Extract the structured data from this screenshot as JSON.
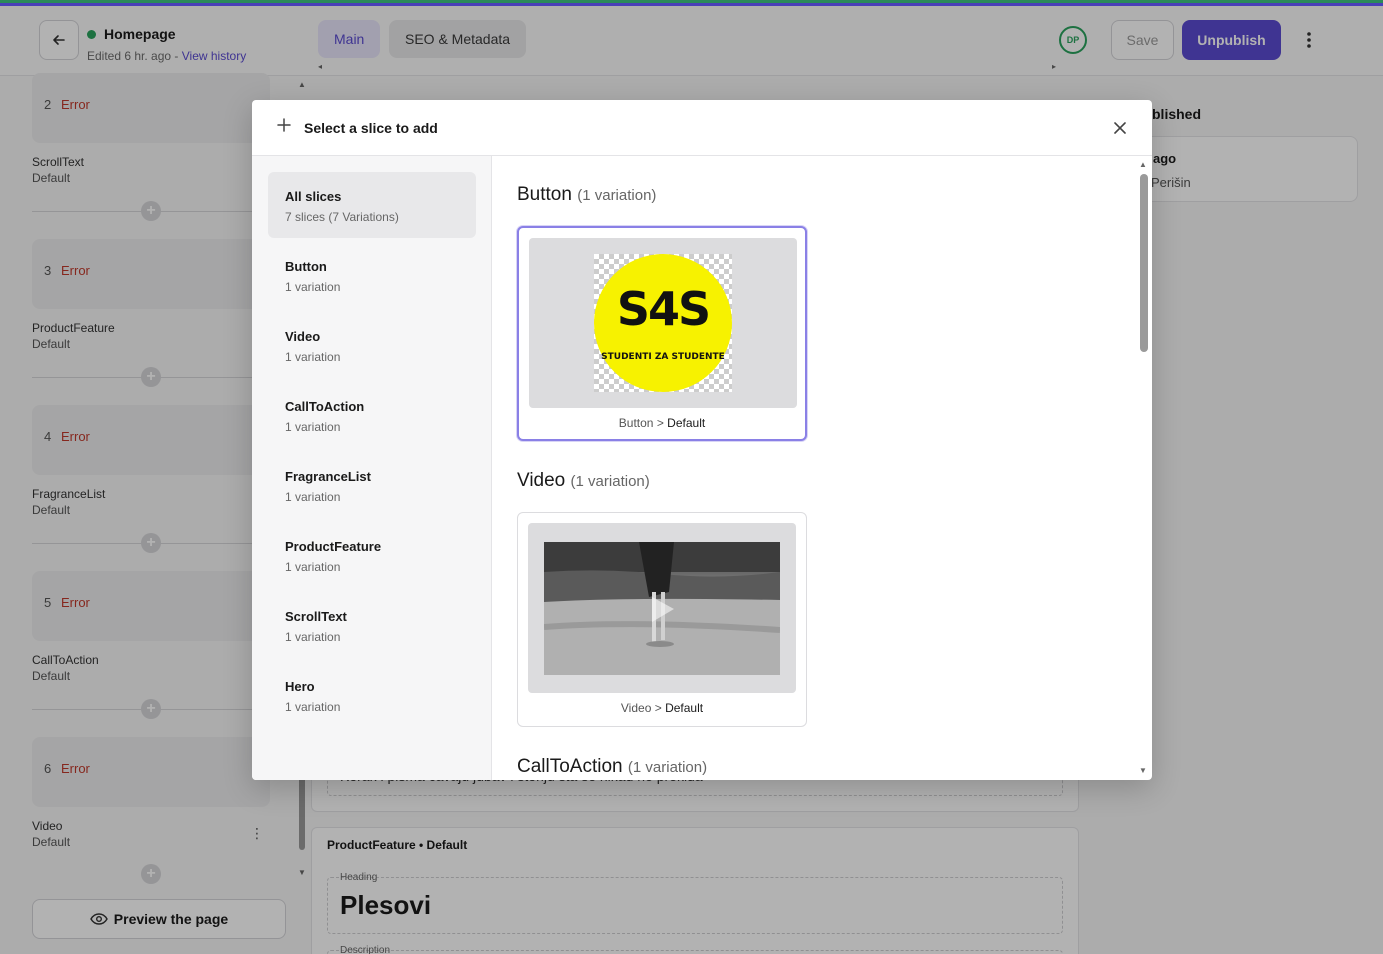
{
  "header": {
    "document_title": "Homepage",
    "edited_text": "Edited 6 hr. ago - ",
    "view_history": "View history",
    "tabs": [
      {
        "label": "Main"
      },
      {
        "label": "SEO & Metadata"
      }
    ],
    "avatar_initials": "DP",
    "save_label": "Save",
    "unpublish_label": "Unpublish"
  },
  "left_panel": {
    "slices": [
      {
        "number": "2",
        "status": "Error",
        "name": "ScrollText",
        "variant": "Default"
      },
      {
        "number": "3",
        "status": "Error",
        "name": "ProductFeature",
        "variant": "Default"
      },
      {
        "number": "4",
        "status": "Error",
        "name": "FragranceList",
        "variant": "Default"
      },
      {
        "number": "5",
        "status": "Error",
        "name": "CallToAction",
        "variant": "Default"
      },
      {
        "number": "6",
        "status": "Error",
        "name": "Video",
        "variant": "Default"
      }
    ],
    "preview_label": "Preview the page"
  },
  "background": {
    "partial_text": "Korak i pisma cavaju jubav i storiju sta se nikad ne prekida",
    "card_title": "ProductFeature • Default",
    "heading_label": "Heading",
    "heading_value": "Plesovi",
    "description_label": "Description",
    "right_status": "blished",
    "right_card_line1": "ago",
    "right_card_line2": "Perišin"
  },
  "modal": {
    "title": "Select a slice to add",
    "sidebar": [
      {
        "label": "All slices",
        "sub": "7 slices (7 Variations)",
        "active": true
      },
      {
        "label": "Button",
        "sub": "1 variation"
      },
      {
        "label": "Video",
        "sub": "1 variation"
      },
      {
        "label": "CallToAction",
        "sub": "1 variation"
      },
      {
        "label": "FragranceList",
        "sub": "1 variation"
      },
      {
        "label": "ProductFeature",
        "sub": "1 variation"
      },
      {
        "label": "ScrollText",
        "sub": "1 variation"
      },
      {
        "label": "Hero",
        "sub": "1 variation"
      }
    ],
    "sections": [
      {
        "name": "Button",
        "count": "(1 variation)",
        "card_slice": "Button",
        "card_sep": " > ",
        "card_variant": "Default"
      },
      {
        "name": "Video",
        "count": "(1 variation)",
        "card_slice": "Video",
        "card_sep": " > ",
        "card_variant": "Default"
      },
      {
        "name": "CallToAction",
        "count": "(1 variation)"
      }
    ],
    "button_preview_logo": {
      "big": "S4S",
      "sub": "STUDENTI ZA STUDENTE"
    }
  },
  "colors": {
    "accent": "#5b4bd1",
    "status_ok": "#2aa35d",
    "error": "#c0392b",
    "logo_yellow": "#f7f200"
  }
}
